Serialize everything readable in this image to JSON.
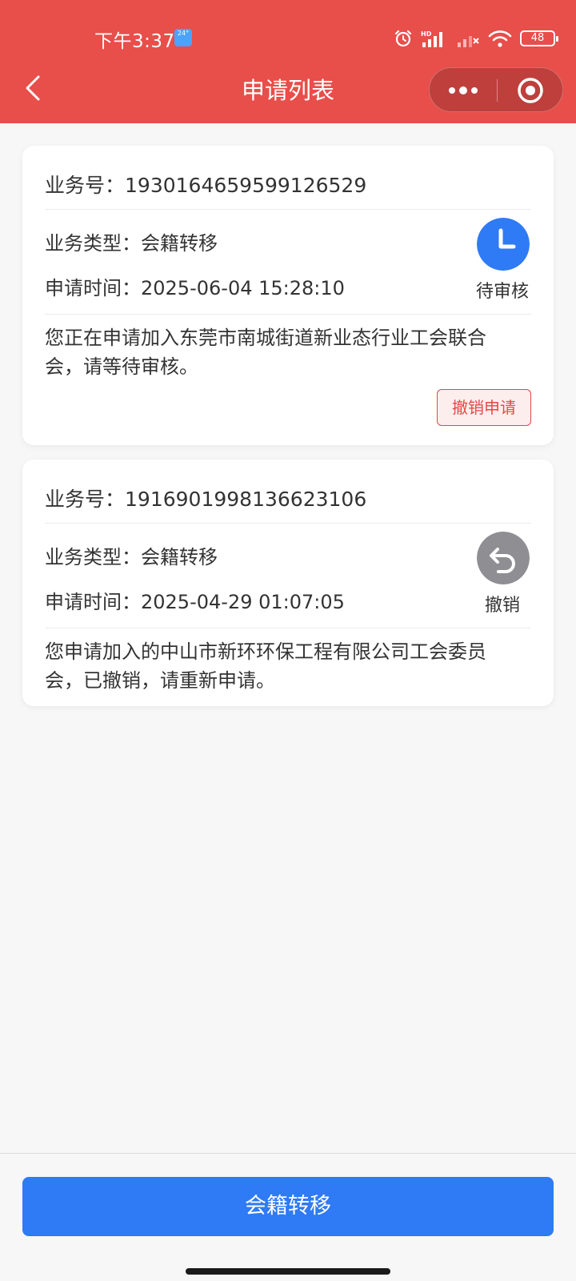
{
  "status_bar": {
    "time": "下午3:37",
    "weather_label": "24°",
    "battery": "48"
  },
  "nav": {
    "title": "申请列表"
  },
  "applications": [
    {
      "id_label": "业务号：",
      "id_value": "1930164659599126529",
      "type_label": "业务类型：",
      "type_value": "会籍转移",
      "time_label": "申请时间：",
      "time_value": "2025-06-04 15:28:10",
      "status": "待审核",
      "status_color": "#2f7af5",
      "desc": "您正在申请加入东莞市南城街道新业态行业工会联合会，请等待审核。",
      "action": "撤销申请"
    },
    {
      "id_label": "业务号：",
      "id_value": "1916901998136623106",
      "type_label": "业务类型：",
      "type_value": "会籍转移",
      "time_label": "申请时间：",
      "time_value": "2025-04-29 01:07:05",
      "status": "撤销",
      "status_color": "#8e8e93",
      "desc": "您申请加入的中山市新环环保工程有限公司工会委员会，已撤销，请重新申请。"
    }
  ],
  "bottom": {
    "primary_label": "会籍转移"
  },
  "colors": {
    "header": "#e84e4a",
    "primary": "#2f7af5",
    "danger": "#e24a45"
  }
}
